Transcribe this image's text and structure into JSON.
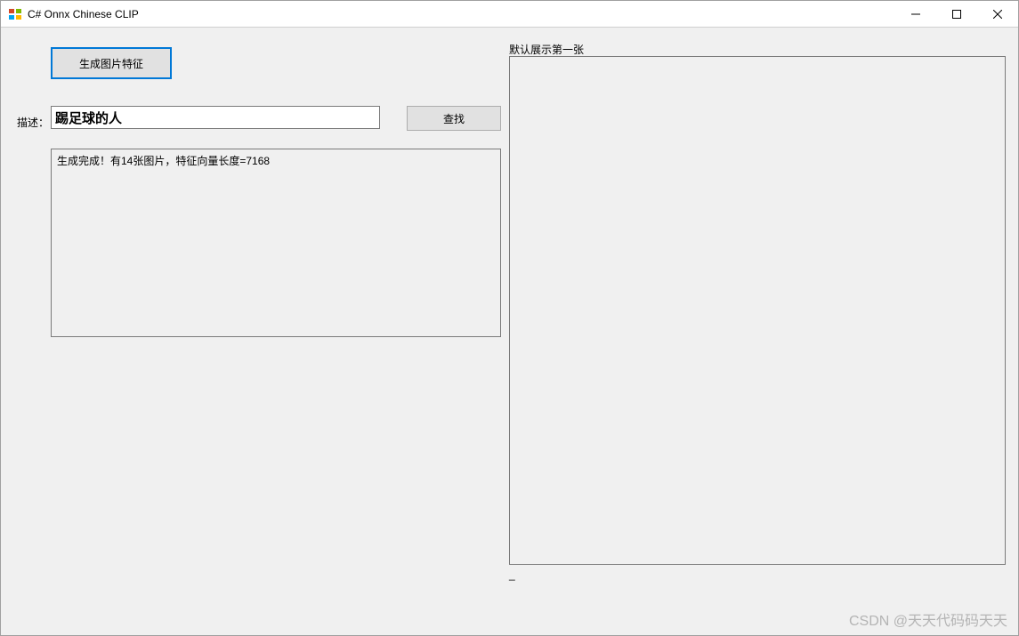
{
  "window": {
    "title": "C# Onnx Chinese CLIP"
  },
  "toolbar": {
    "generate_label": "生成图片特征"
  },
  "description": {
    "label": "描述：",
    "value": "踢足球的人"
  },
  "search": {
    "label": "查找"
  },
  "log": {
    "content": "生成完成！有14张图片，特征向量长度=7168"
  },
  "preview": {
    "label": "默认展示第一张",
    "dash": "_"
  },
  "watermark": "CSDN @天天代码码天天"
}
